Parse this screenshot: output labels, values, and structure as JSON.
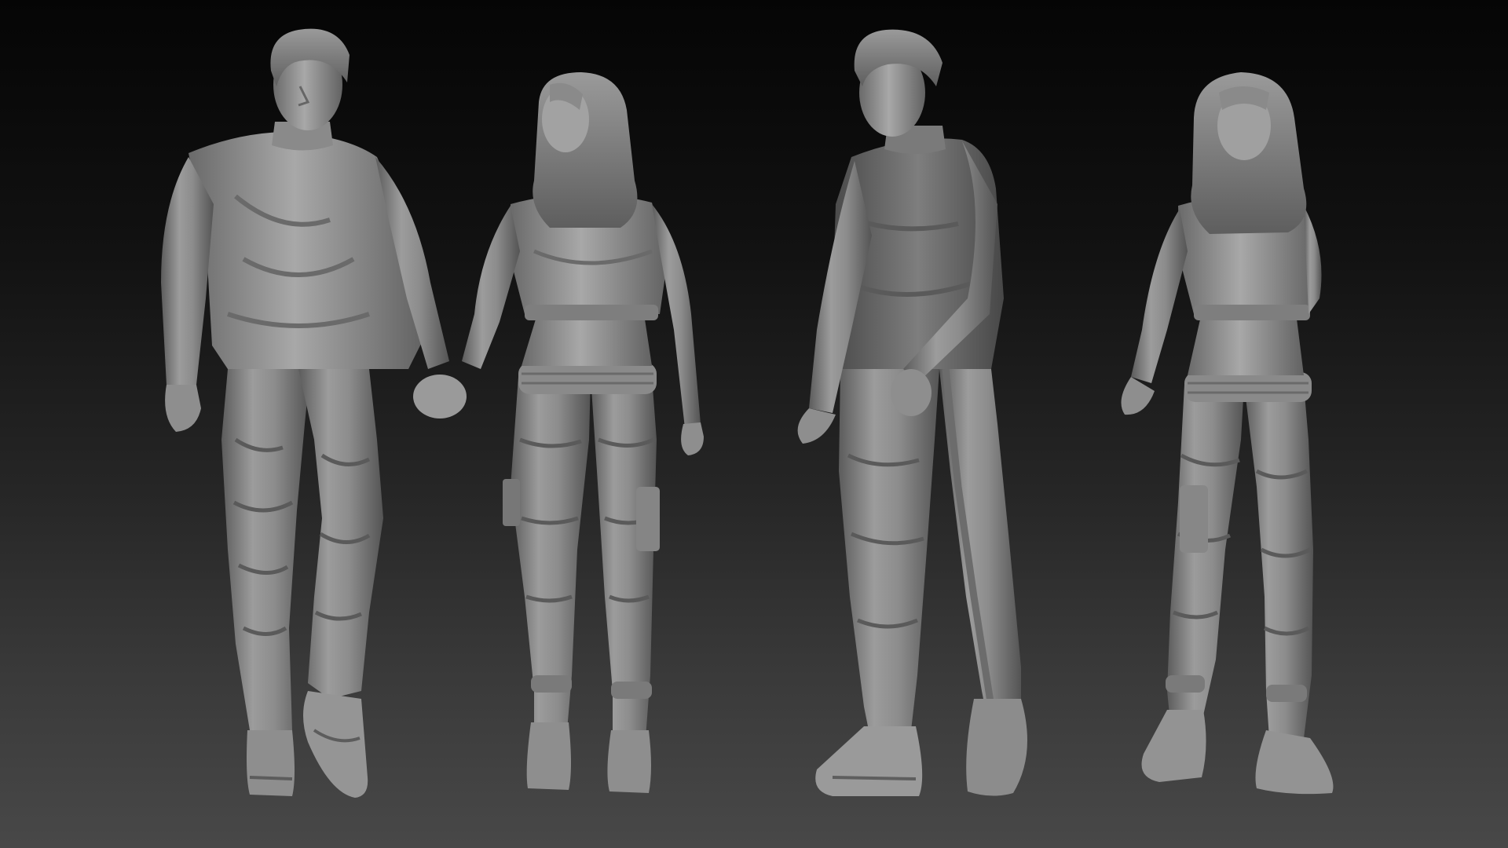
{
  "scene": {
    "subject_count": 4,
    "background_colors": [
      "#050505",
      "#121212",
      "#262626",
      "#3a3a3a",
      "#484848"
    ],
    "clay_colors": {
      "light": "#a4a4a4",
      "mid": "#808080",
      "shadow": "#5a5a5a",
      "deep": "#3e3e3e"
    }
  }
}
